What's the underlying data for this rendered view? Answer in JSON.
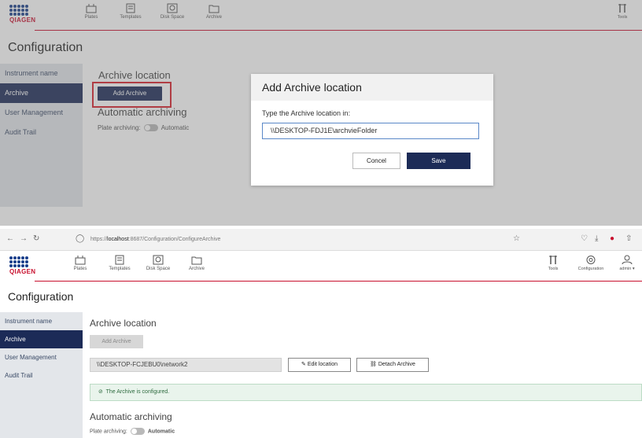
{
  "logo": {
    "text": "QIAGEN"
  },
  "nav": {
    "plates": "Plates",
    "templates": "Templates",
    "disk_space": "Disk Space",
    "archive": "Archive",
    "tools": "Tools",
    "configuration": "Configuration",
    "user": "admin ▾"
  },
  "page": {
    "title": "Configuration"
  },
  "sidebar": {
    "items": [
      {
        "label": "Instrument name"
      },
      {
        "label": "Archive"
      },
      {
        "label": "User Management"
      },
      {
        "label": "Audit Trail"
      }
    ]
  },
  "top": {
    "archive_location_heading": "Archive location",
    "add_archive_label": "Add Archive",
    "auto_archiving_heading": "Automatic archiving",
    "plate_archiving_label": "Plate archiving:",
    "toggle_label": "Automatic",
    "dialog": {
      "title": "Add Archive location",
      "prompt": "Type the Archive location in:",
      "input_value": "\\\\DESKTOP-FDJ1E\\archvieFolder",
      "cancel_label": "Concel",
      "save_label": "Save"
    }
  },
  "browser": {
    "url_prefix": "https://",
    "url_host": "localhost",
    "url_rest": ":8687/Configuration/ConfigureArchive"
  },
  "bottom": {
    "archive_location_heading": "Archive location",
    "add_archive_label": "Add Archive",
    "path_value": "\\\\DESKTOP-FCJEBU0\\network2",
    "edit_location_label": "Edit location",
    "detach_archive_label": "Detach Archive",
    "configured_message": "The Archive is configured.",
    "auto_archiving_heading": "Automatic archiving",
    "plate_archiving_label": "Plate archiving:",
    "toggle_label": "Automatic"
  }
}
